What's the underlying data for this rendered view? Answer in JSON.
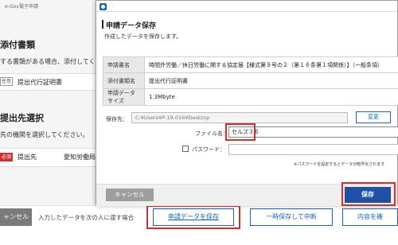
{
  "background": {
    "title": "e-Gov電子申請",
    "section1_heading": "添付書類",
    "section1_text": "する書類がある場合、添付してくだ",
    "attachment_badge": "任意",
    "attachment_label": "提出代行証明書",
    "section2_heading": "提出先選択",
    "section2_text": "先の機関を選択してください。",
    "dest_badge": "必須",
    "dest_label": "提出先",
    "dest_value": "愛知労働局"
  },
  "bottom_bar": {
    "cancel_label": "ャンセル",
    "hint_text": "入力したデータを次の人に渡す場合",
    "apply_save_label": "申請データを保存",
    "temp_save_label": "一時保存して中断",
    "confirm_label": "内容を確"
  },
  "dialog": {
    "title": "申請データ保存",
    "subtitle": "作成したデータを保存します。",
    "rows": [
      {
        "key": "申請書名",
        "value": "時間外労働／休日労働に関する協定届【様式第９号の２（第１６条第１項関係）】（一般条項）"
      },
      {
        "key": "添付書類名",
        "value": "提出代行証明書"
      },
      {
        "key": "申請データサイズ",
        "value": "1.3Mbyte"
      }
    ],
    "save_location_label": "保存先：",
    "save_location_value": "C:¥Users¥P-19-016¥Desktop",
    "change_label": "変更",
    "filename_label": "ファイル名：",
    "filename_value": "セルズ３６",
    "password_label": "パスワード：",
    "password_note": "※パスワードを設定するとデータが暗号化されます",
    "cancel_label": "キャンセル",
    "save_label": "保存"
  },
  "colors": {
    "accent": "#1e50a8",
    "highlight": "#d32f2f",
    "required_badge": "#d32f2f"
  }
}
